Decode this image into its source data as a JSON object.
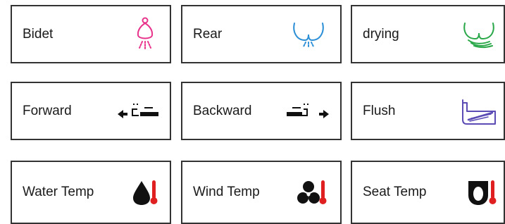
{
  "buttons": [
    {
      "label": "Bidet",
      "icon": "bidet-spray-icon",
      "icon_color": "#e8318a"
    },
    {
      "label": "Rear",
      "icon": "rear-wash-icon",
      "icon_color": "#2d8fd6"
    },
    {
      "label": "drying",
      "icon": "drying-air-icon",
      "icon_color": "#2aa84a"
    },
    {
      "label": "Forward",
      "icon": "nozzle-forward-icon",
      "icon_color": "#111111"
    },
    {
      "label": "Backward",
      "icon": "nozzle-backward-icon",
      "icon_color": "#111111"
    },
    {
      "label": "Flush",
      "icon": "flush-tank-icon",
      "icon_color": "#5a4bb5"
    },
    {
      "label": "Water Temp",
      "icon": "water-temp-icon",
      "icon_color": "#111111"
    },
    {
      "label": "Wind Temp",
      "icon": "wind-temp-icon",
      "icon_color": "#111111"
    },
    {
      "label": "Seat Temp",
      "icon": "seat-temp-icon",
      "icon_color": "#111111"
    }
  ],
  "accent_colors": {
    "thermometer": "#e02020",
    "border": "#333333"
  }
}
